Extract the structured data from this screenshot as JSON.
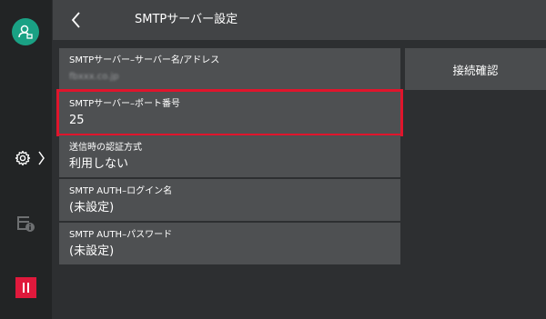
{
  "header": {
    "title": "SMTPサーバー設定"
  },
  "settings": [
    {
      "label": "SMTPサーバー–サーバー名/アドレス",
      "value": "fbxxx.co.jp",
      "blurred": true
    },
    {
      "label": "SMTPサーバー–ポート番号",
      "value": "25",
      "selected": true
    },
    {
      "label": "送信時の認証方式",
      "value": "利用しない"
    },
    {
      "label": "SMTP AUTH–ログイン名",
      "value": "(未設定)"
    },
    {
      "label": "SMTP AUTH–パスワード",
      "value": "(未設定)"
    }
  ],
  "actions": {
    "confirm_label": "接続確認"
  },
  "colors": {
    "accent": "#1aa184",
    "alert": "#e0193c",
    "selection_border": "#e0152c"
  },
  "icons": [
    "user-icon",
    "back-icon",
    "gear-icon",
    "chevron-right-icon",
    "printer-info-icon",
    "pause-icon"
  ]
}
